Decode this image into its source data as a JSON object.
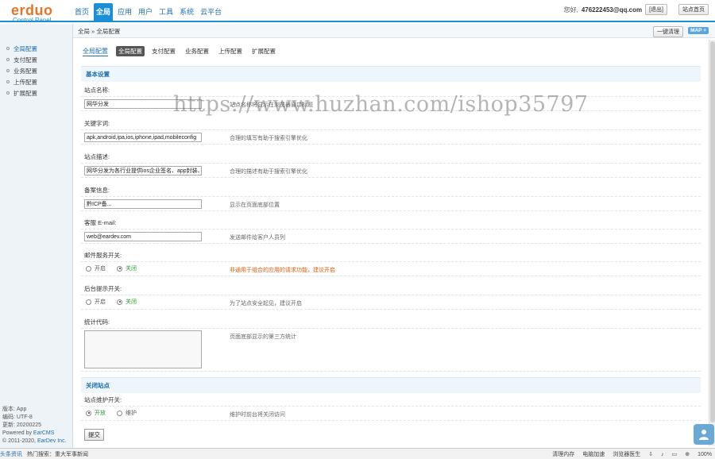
{
  "header": {
    "logo_main": "erduo",
    "logo_sub": "Control Panel",
    "nav": [
      {
        "label": "首页",
        "active": false
      },
      {
        "label": "全局",
        "active": true
      },
      {
        "label": "应用",
        "active": false
      },
      {
        "label": "用户",
        "active": false
      },
      {
        "label": "工具",
        "active": false
      },
      {
        "label": "系统",
        "active": false
      },
      {
        "label": "云平台",
        "active": false
      }
    ],
    "greeting": "您好,",
    "username": "476222453@qq.com",
    "logout_label": "[退出]",
    "site_home_label": "站点首页"
  },
  "sidebar": {
    "items": [
      {
        "label": "全局配置",
        "active": true
      },
      {
        "label": "支付配置",
        "active": false
      },
      {
        "label": "业务配置",
        "active": false
      },
      {
        "label": "上传配置",
        "active": false
      },
      {
        "label": "扩展配置",
        "active": false
      }
    ],
    "info": {
      "version": "版本: App",
      "encoding": "编码: UTF-8",
      "updated": "更新: 20200225",
      "powered_prefix": "Powered by ",
      "powered_link": "EarCMS",
      "copyright_prefix": "© 2011-2020, ",
      "copyright_link": "EarDev Inc."
    }
  },
  "breadcrumb": {
    "text": "全局 » 全局配置",
    "cache_button": "一键清理",
    "map_button": "MAP"
  },
  "tabs": {
    "title": "全局配置",
    "items": [
      {
        "label": "全局配置",
        "active": true
      },
      {
        "label": "支付配置",
        "active": false
      },
      {
        "label": "业务配置",
        "active": false
      },
      {
        "label": "上传配置",
        "active": false
      },
      {
        "label": "扩展配置",
        "active": false
      }
    ]
  },
  "form": {
    "section_basic": "基本设置",
    "site_name": {
      "label": "站点名称:",
      "value": "网华分发",
      "hint": "站点名称将显示在浏览器窗口标题"
    },
    "keywords": {
      "label": "关键字词:",
      "value": "apk,android,ipa,ios,iphone,ipad,mobileconfig",
      "hint": "合理的填写有助于搜索引擎优化"
    },
    "description": {
      "label": "站点描述:",
      "value": "网华分发为各行业提供ios企业签名、app封装、",
      "hint": "合理的描述有助于搜索引擎优化"
    },
    "icp": {
      "label": "备案信息:",
      "value": "黔ICP备...",
      "hint": "显示在页面底部位置"
    },
    "email": {
      "label": "客服 E-mail:",
      "value": "web@eardev.com",
      "hint": "发送邮件给客户人员列"
    },
    "mail_switch": {
      "label": "邮件服务开关:",
      "on_label": "开启",
      "off_label": "关闭",
      "selected": "off",
      "hint": "非通用于组合的应用的请求功能，建议开启"
    },
    "admin_notice": {
      "label": "后台提示开关:",
      "on_label": "开启",
      "off_label": "关闭",
      "selected": "off",
      "hint": "为了站点安全起见，建议开启"
    },
    "stats_code": {
      "label": "统计代码:",
      "value": "",
      "hint": "页面底部显示的第三方统计"
    },
    "section_close": "关闭站点",
    "maintenance": {
      "label": "站点维护开关:",
      "on_label": "开放",
      "off_label": "维护",
      "selected": "on",
      "hint": "维护时前台将关闭访问"
    },
    "submit_label": "提交"
  },
  "watermark": "https://www.huzhan.com/ishop35797",
  "statusbar": {
    "news_link": "头条资讯",
    "hot_search": "热门搜索：重大军事新闻",
    "items": [
      "清理内存",
      "电脑加速",
      "浏览器医生",
      "",
      "",
      "",
      "",
      "100%"
    ]
  }
}
